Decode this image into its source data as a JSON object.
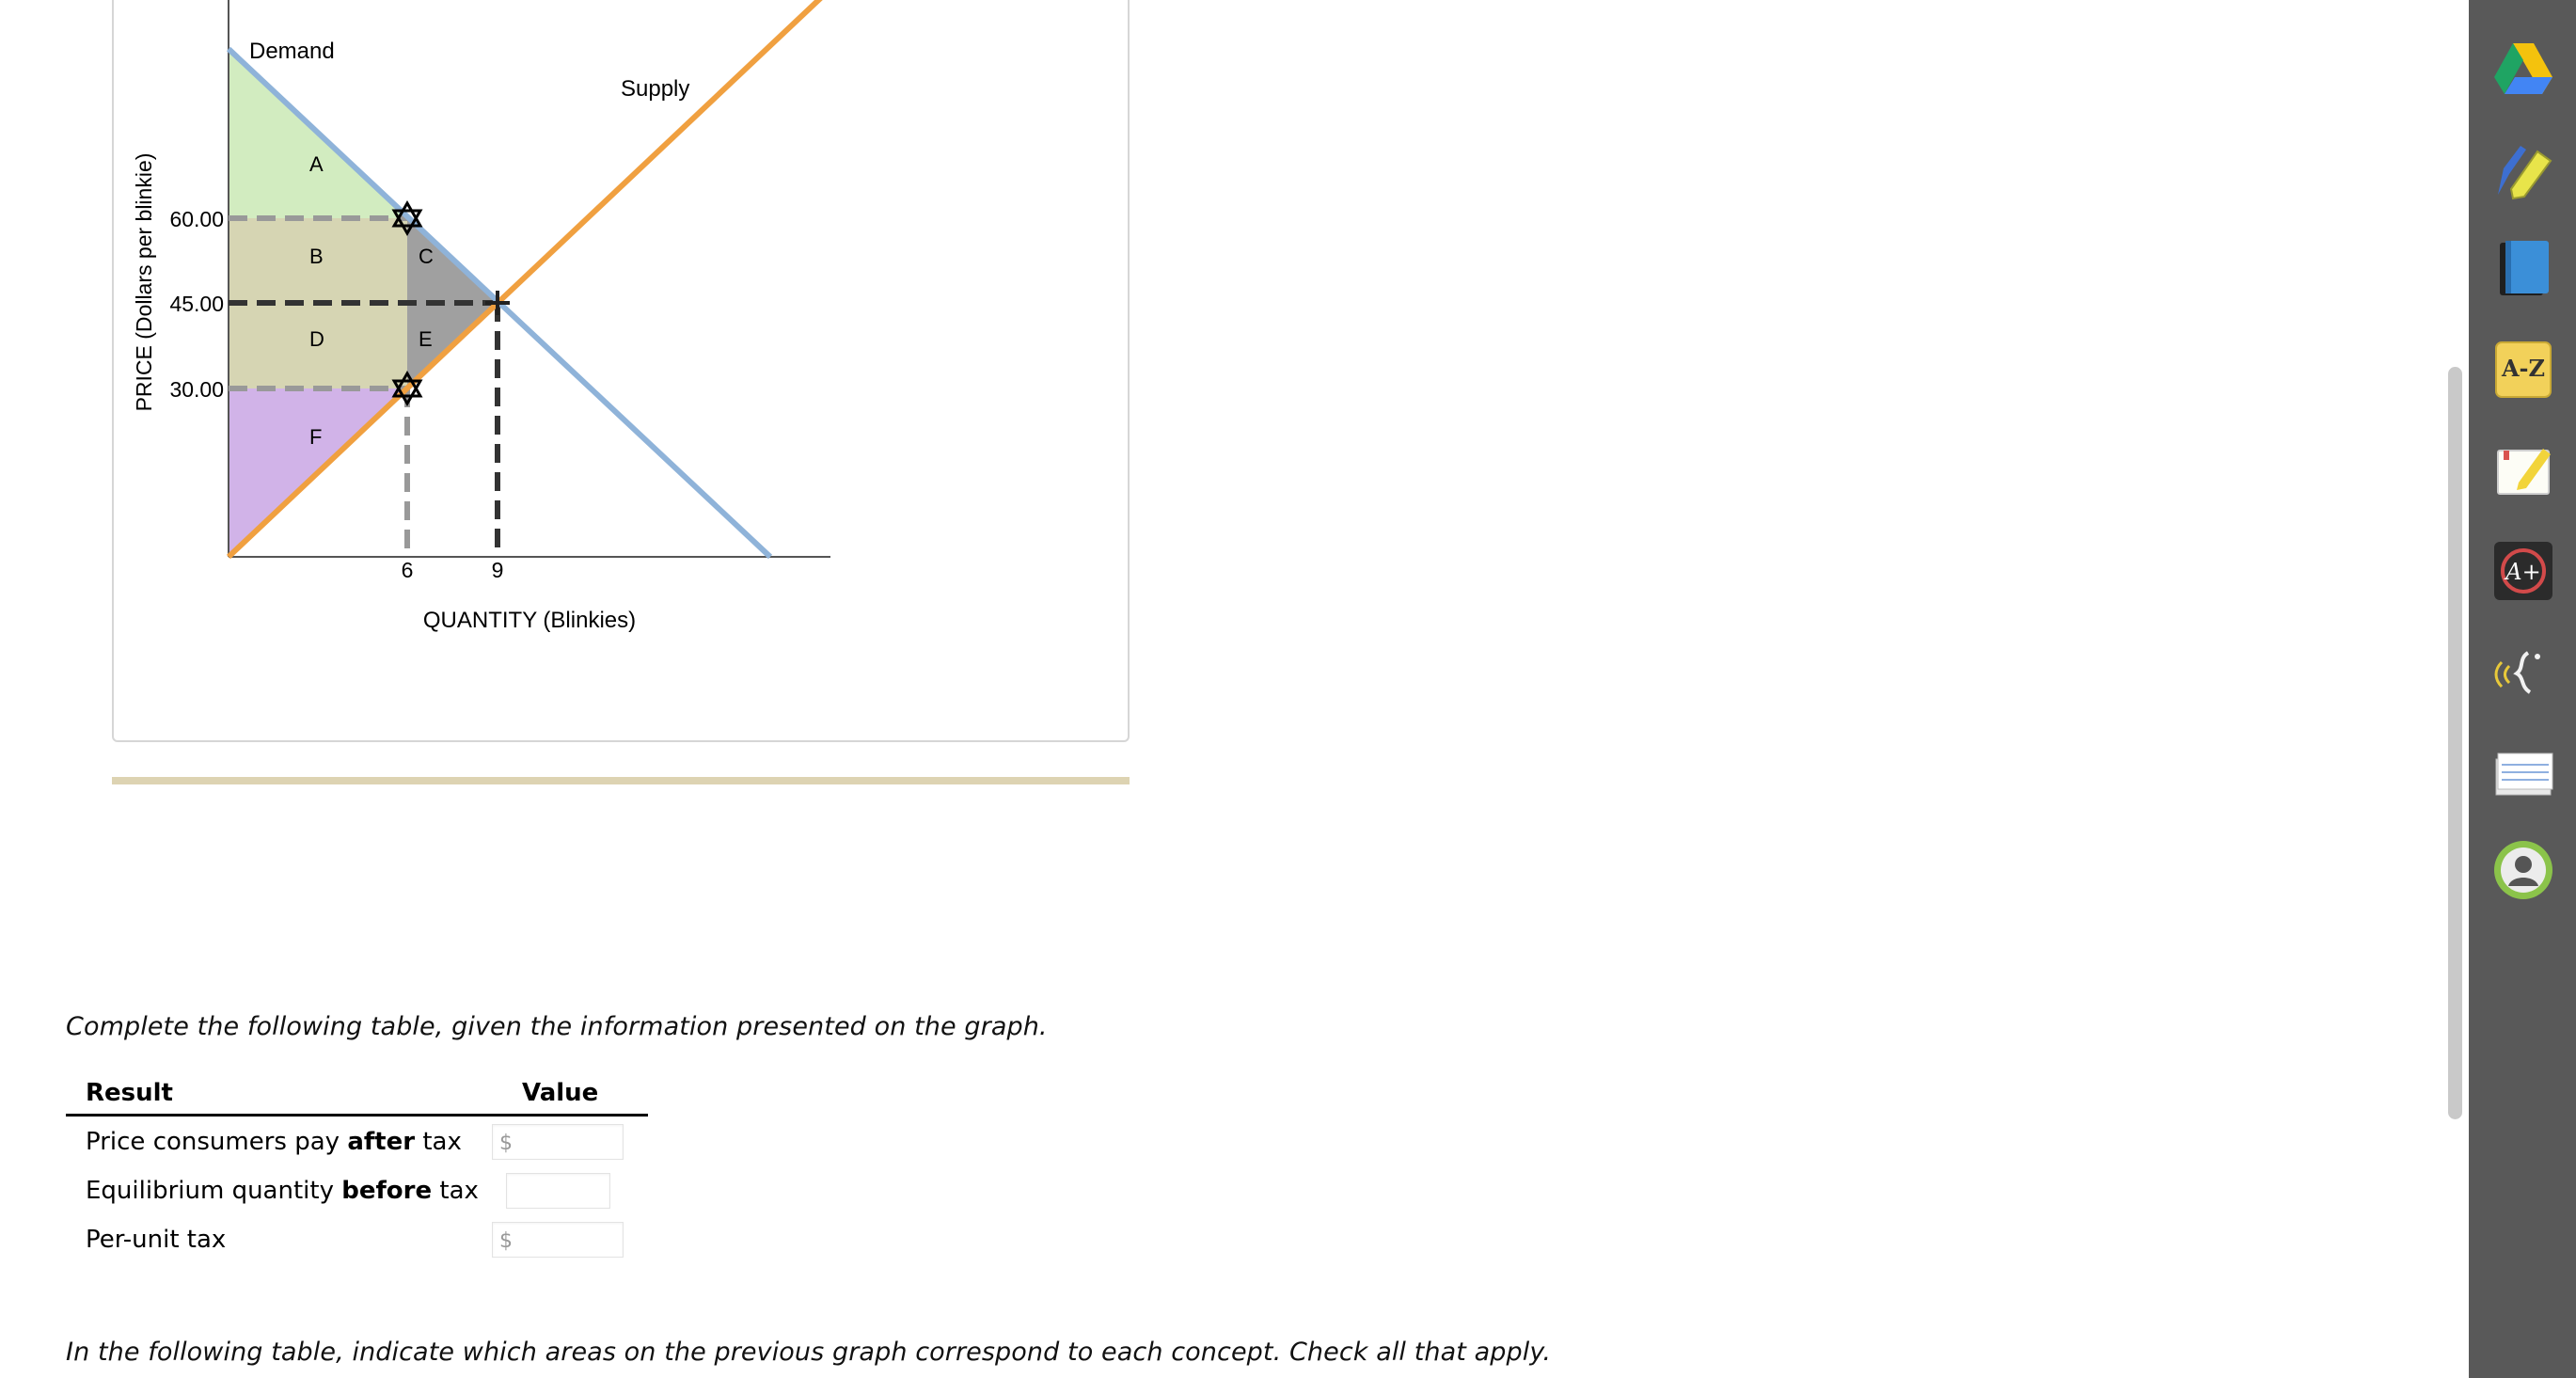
{
  "graph": {
    "demand_label": "Demand",
    "supply_label": "Supply",
    "y_axis_label": "PRICE (Dollars per blinkie)",
    "x_axis_label": "QUANTITY (Blinkies)",
    "y_ticks": [
      "60.00",
      "45.00",
      "30.00"
    ],
    "x_ticks": [
      "6",
      "9"
    ],
    "areas": [
      "A",
      "B",
      "C",
      "D",
      "E",
      "F"
    ],
    "colors": {
      "demand": "#8fb3d9",
      "supply": "#f0a040",
      "area_A": "#d2ecc0",
      "area_BD": "#d6d5b3",
      "area_CE": "#a0a0a0",
      "area_F": "#d1b3e8"
    }
  },
  "chart_data": {
    "type": "line",
    "xlabel": "QUANTITY (Blinkies)",
    "ylabel": "PRICE (Dollars per blinkie)",
    "series": [
      {
        "name": "Demand",
        "x": [
          0,
          18
        ],
        "y": [
          90,
          0
        ]
      },
      {
        "name": "Supply",
        "x": [
          0,
          18
        ],
        "y": [
          0,
          90
        ]
      }
    ],
    "markers": [
      {
        "x": 6,
        "y": 60
      },
      {
        "x": 6,
        "y": 30
      },
      {
        "x": 9,
        "y": 45
      }
    ],
    "areas": [
      "A",
      "B",
      "C",
      "D",
      "E",
      "F"
    ]
  },
  "questions": {
    "instruction1": "Complete the following table, given the information presented on the graph.",
    "instruction2": "In the following table, indicate which areas on the previous graph correspond to each concept. Check all that apply."
  },
  "table": {
    "header_result": "Result",
    "header_value": "Value",
    "rows": [
      {
        "pre": "Price consumers pay ",
        "bold": "after",
        "post": " tax",
        "dollar": "$",
        "value": ""
      },
      {
        "pre": "Equilibrium quantity ",
        "bold": "before",
        "post": " tax",
        "dollar": "",
        "value": ""
      },
      {
        "pre": "Per-unit tax",
        "bold": "",
        "post": "",
        "dollar": "$",
        "value": ""
      }
    ]
  },
  "toolbar": {
    "items": [
      "google-drive-icon",
      "highlighter-icon",
      "book-icon",
      "dictionary-az-icon",
      "notes-icon",
      "grade-a-plus-icon",
      "read-aloud-icon",
      "flashcards-icon",
      "profile-icon"
    ],
    "az_label": "A-Z"
  }
}
